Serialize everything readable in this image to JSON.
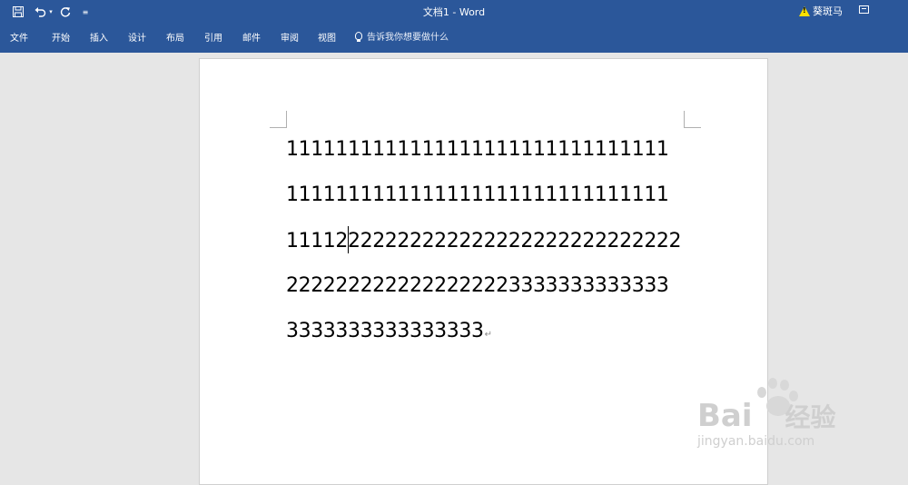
{
  "window": {
    "title": "文档1  -  Word",
    "user_name": "葵斑马",
    "warning_icon": "warning-icon",
    "accent": "#2b579a"
  },
  "quick_access": {
    "save_icon": "save-icon",
    "undo_icon": "undo-icon",
    "dropdown_icon": "chevron-down-icon",
    "redo_icon": "redo-icon",
    "customize_icon": "customize-icon"
  },
  "ribbon": {
    "tabs": [
      "文件",
      "开始",
      "插入",
      "设计",
      "布局",
      "引用",
      "邮件",
      "审阅",
      "视图"
    ],
    "tell_me": "告诉我你想要做什么"
  },
  "document": {
    "lines": [
      "1111111111111111111111111111111",
      "1111111111111111111111111111111",
      "11112",
      "2222222222222222222222222222222",
      "3333333333333333"
    ],
    "line3_after_caret": "222222222222222222222222222",
    "line4_twos": "222222222222222222",
    "line4_threes": "3333333333333",
    "paragraph_mark": "↵"
  },
  "watermark": {
    "brand": "Bai",
    "brand_suffix": "经验",
    "url": "jingyan.baidu.com"
  }
}
